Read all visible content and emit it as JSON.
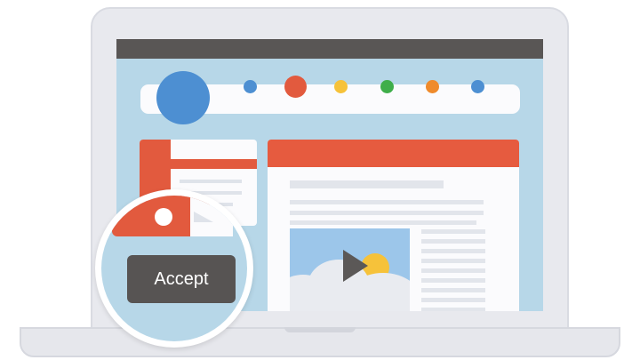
{
  "colors": {
    "screen_bg": "#b7d7e8",
    "title_bar": "#595655",
    "accent_red": "#e25a3e",
    "button_bg": "#575453",
    "avatar": "#4d8fd2"
  },
  "toolbar": {
    "dots": [
      "#4d8fd2",
      "#e25a3e",
      "#f6c23a",
      "#3fae4a",
      "#ef8b2c",
      "#4d8fd2"
    ]
  },
  "media": {
    "icon": "play-icon"
  },
  "magnifier": {
    "button_label": "Accept"
  }
}
